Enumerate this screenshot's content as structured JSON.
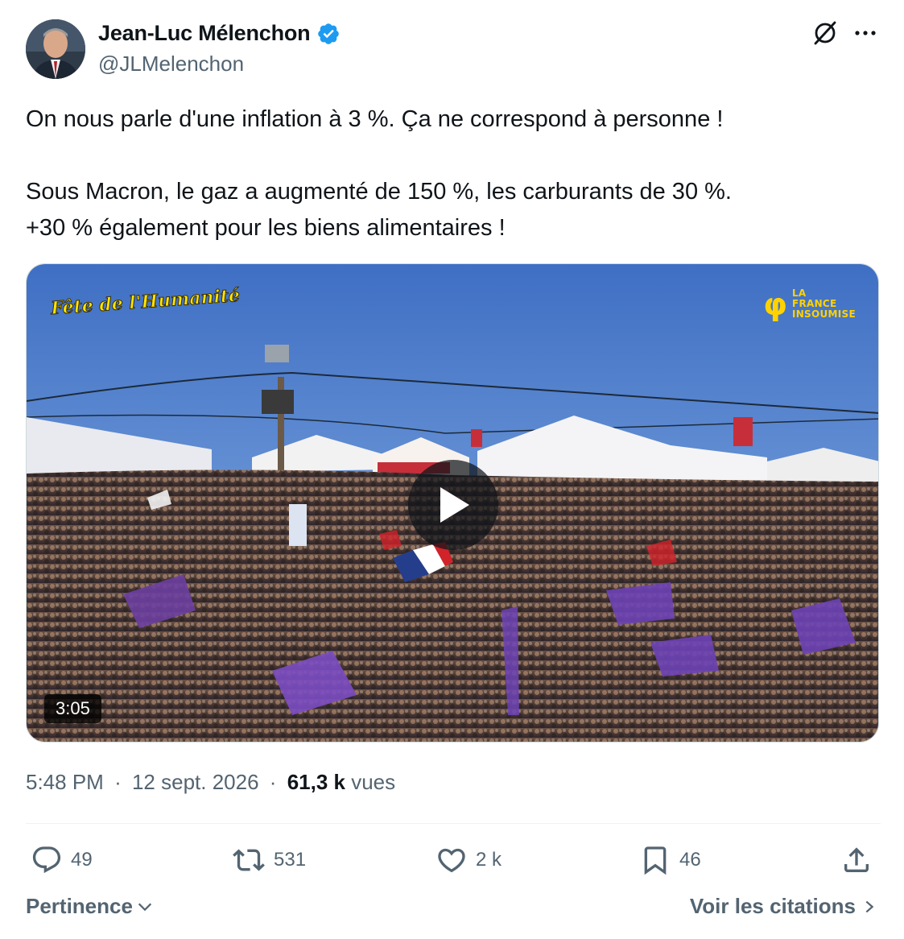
{
  "author": {
    "display_name": "Jean-Luc Mélenchon",
    "handle": "@JLMelenchon",
    "verified": true,
    "verified_color": "#1d9bf0"
  },
  "header_icons": [
    "grok-icon",
    "more-icon"
  ],
  "tweet": {
    "text_line_1": "On nous parle d'une inflation à 3 %. Ça ne correspond à personne !",
    "text_line_2": "Sous Macron, le gaz a augmenté de 150 %, les carburants de 30 %.",
    "text_line_3": "+30 % également pour les biens alimentaires !"
  },
  "media": {
    "type": "video",
    "duration": "3:05",
    "watermark_left": "Fête de l'Humanité",
    "watermark_right_symbol": "φ",
    "watermark_right_text": "LA\nFRANCE\nINSOUMISE",
    "watermark_color": "#ffd200"
  },
  "meta": {
    "time": "5:48 PM",
    "date": "12 sept. 2026",
    "views_count": "61,3 k",
    "views_label": "vues",
    "separator": "·"
  },
  "actions": {
    "replies": "49",
    "reposts": "531",
    "likes": "2 k",
    "bookmarks": "46"
  },
  "footer": {
    "sort_label": "Pertinence",
    "quotes_label": "Voir les citations"
  },
  "colors": {
    "text_primary": "#0f1419",
    "text_secondary": "#536471",
    "divider": "#eff3f4",
    "accent": "#1d9bf0"
  }
}
